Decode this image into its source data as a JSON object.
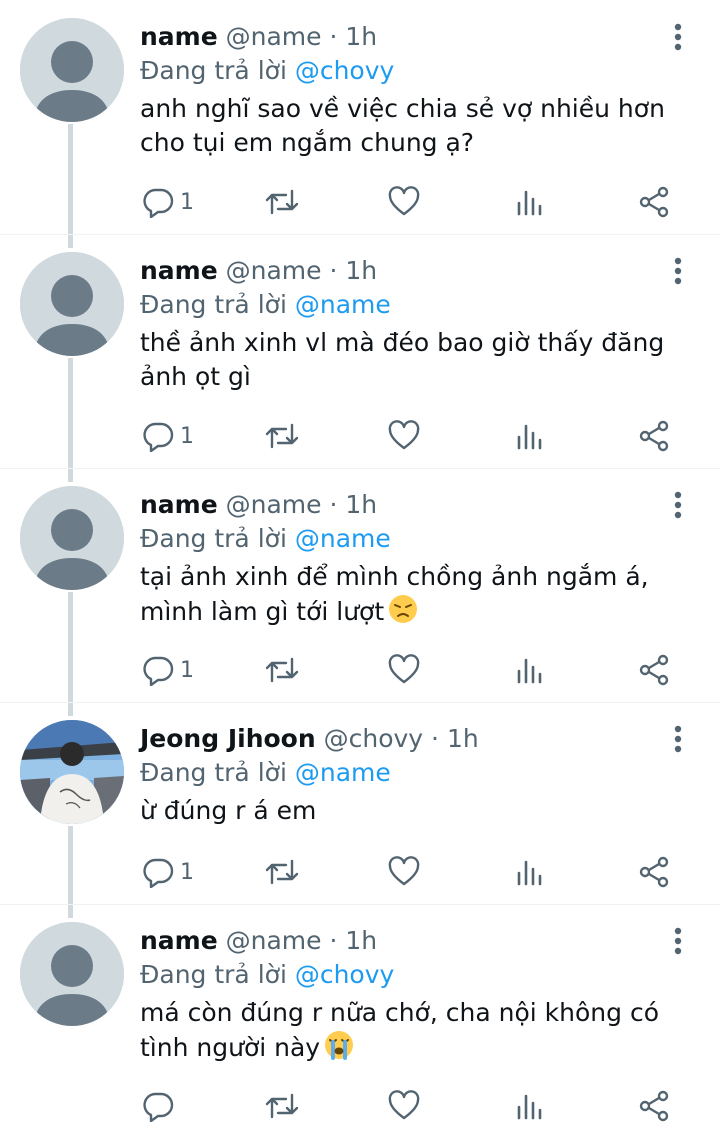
{
  "colors": {
    "accent": "#1d9bf0",
    "muted": "#536471",
    "avatar_placeholder": "#cfd9de",
    "thread_line": "#cfd9de"
  },
  "icons": [
    "reply-icon",
    "retweet-icon",
    "like-icon",
    "views-icon",
    "share-icon",
    "more-icon"
  ],
  "tweets": [
    {
      "display_name": "name",
      "handle": "@name",
      "time": "· 1h",
      "replying_label": "Đang trả lời",
      "replying_to": "@chovy",
      "line1": "anh nghĩ sao về việc chia sẻ vợ nhiều hơn",
      "line2": "cho tụi em ngắm chung ạ?",
      "reply_count": "1",
      "emoji": ""
    },
    {
      "display_name": "name",
      "handle": "@name",
      "time": "· 1h",
      "replying_label": "Đang trả lời",
      "replying_to": "@name",
      "line1": "thề ảnh xinh vl mà đéo bao giờ thấy đăng",
      "line2": "ảnh ọt gì",
      "reply_count": "1",
      "emoji": ""
    },
    {
      "display_name": "name",
      "handle": "@name",
      "time": "· 1h",
      "replying_label": "Đang trả lời",
      "replying_to": "@name",
      "line1": "tại ảnh xinh để mình chồng ảnh ngắm á,",
      "line2": "mình làm gì tới lượt",
      "reply_count": "1",
      "emoji": "disappointed-face"
    },
    {
      "display_name": "Jeong Jihoon",
      "handle": "@chovy",
      "time": "· 1h",
      "replying_label": "Đang trả lời",
      "replying_to": "@name",
      "line1": "ừ đúng r á em",
      "line2": "",
      "reply_count": "1",
      "emoji": ""
    },
    {
      "display_name": "name",
      "handle": "@name",
      "time": "· 1h",
      "replying_label": "Đang trả lời",
      "replying_to": "@chovy",
      "line1": "má còn đúng r nữa chớ, cha nội không có",
      "line2": "tình người này",
      "reply_count": "",
      "emoji": "loudly-crying-face"
    }
  ]
}
